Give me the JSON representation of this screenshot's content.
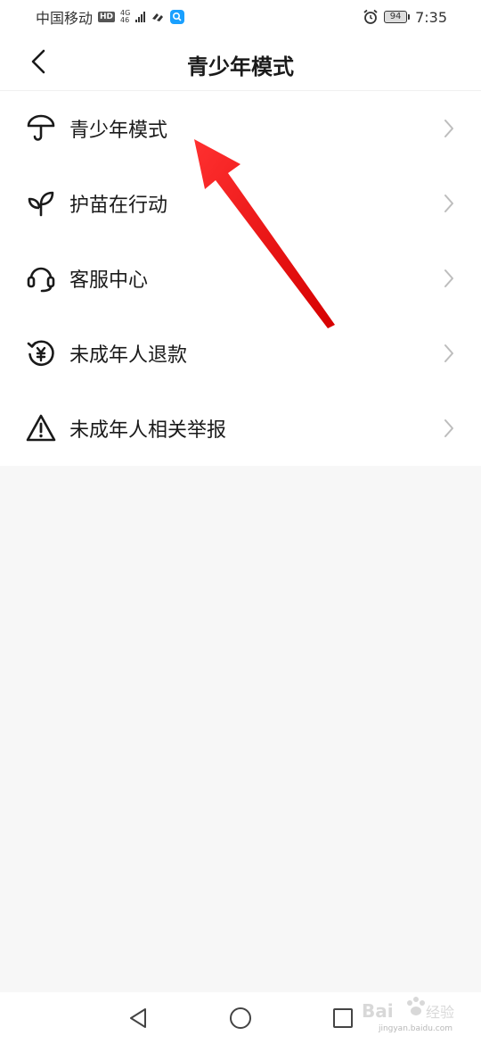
{
  "status_bar": {
    "carrier": "中国移动",
    "hd": "HD",
    "network": "4G",
    "network_sub": "46",
    "battery": "94",
    "time": "7:35"
  },
  "header": {
    "title": "青少年模式"
  },
  "menu": [
    {
      "label": "青少年模式",
      "icon": "umbrella-icon"
    },
    {
      "label": "护苗在行动",
      "icon": "sprout-icon"
    },
    {
      "label": "客服中心",
      "icon": "headset-icon"
    },
    {
      "label": "未成年人退款",
      "icon": "yen-refund-icon"
    },
    {
      "label": "未成年人相关举报",
      "icon": "warning-icon"
    }
  ],
  "annotation": {
    "arrow_color": "#f01818"
  },
  "watermark": {
    "brand": "Bai",
    "brand_cn": "经验",
    "site": "jingyan.baidu.com"
  },
  "colors": {
    "icon": "#1a1a1a",
    "chevron": "#bdbdbd",
    "background": "#f7f7f7"
  }
}
